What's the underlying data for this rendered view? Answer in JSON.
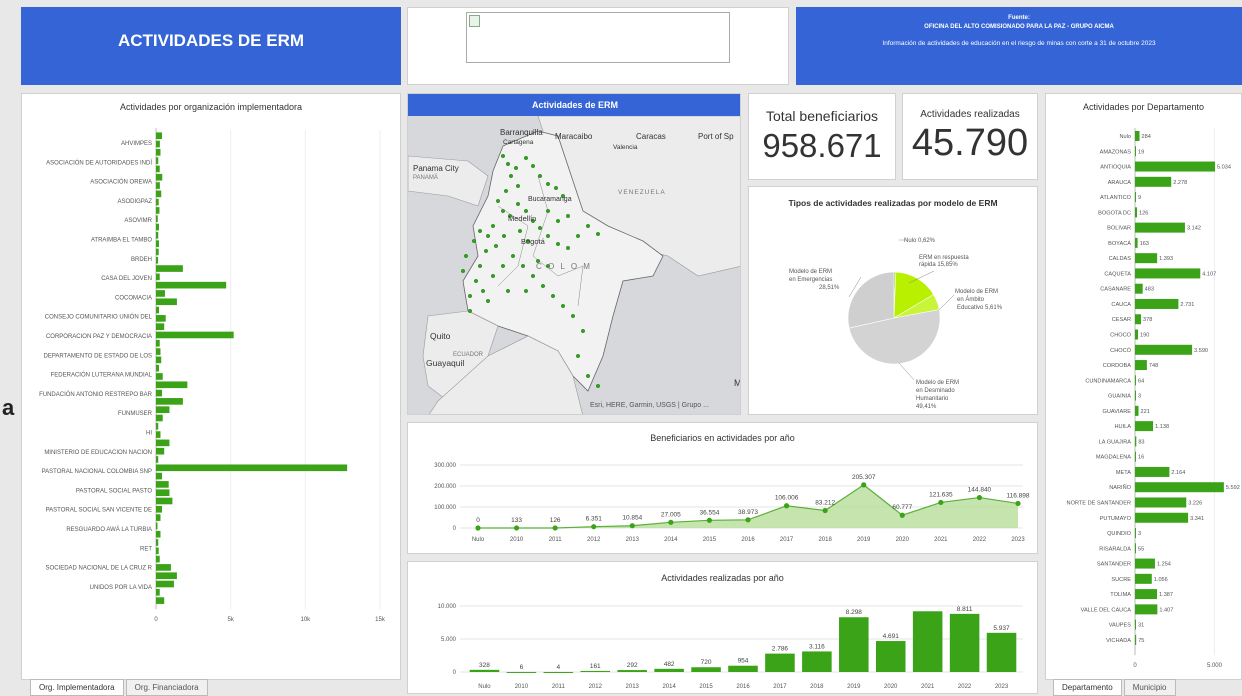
{
  "header": {
    "title": "ACTIVIDADES DE ERM",
    "source_label": "Fuente:",
    "source_org": "OFICINA DEL ALTO COMISIONADO PARA LA PAZ - GRUPO AICMA",
    "source_note": "Información de actividades de educación en el riesgo de minas con corte a 31 de octubre 2023"
  },
  "side_letter": "a",
  "kpis": {
    "beneficiarios_label": "Total beneficiarios",
    "beneficiarios_value": "958.671",
    "actividades_label": "Actividades realizadas",
    "actividades_value": "45.790"
  },
  "map": {
    "title": "Actividades de ERM",
    "labels": {
      "barranquilla": "Barranquilla",
      "cartagena": "Cartagena",
      "maracaibo": "Maracaibo",
      "caracas": "Caracas",
      "valencia": "Valencia",
      "port": "Port of Sp",
      "panama_city": "Panama City",
      "panama": "PANAMÁ",
      "venezuela": "VENEZUELA",
      "medellin": "Medellín",
      "bucaramanga": "Bucaramanga",
      "bogota": "Bogotá",
      "colombia": "C O L O M",
      "quito": "Quito",
      "ecuador": "ECUADOR",
      "guayaquil": "Guayaquil",
      "m": "M"
    },
    "attribution": "Esri, HERE, Garmin, USGS | Grupo ..."
  },
  "tabs_left": [
    "Org. Implementadora",
    "Org. Financiadora"
  ],
  "tabs_right": [
    "Departamento",
    "Municipio"
  ],
  "colors": {
    "accent": "#3464d6",
    "bar": "#3aa317",
    "pie_grey": "#d3d3d3",
    "pie_lime": "#b8f000"
  },
  "chart_data": [
    {
      "type": "bar",
      "orientation": "horizontal",
      "title": "Actividades por organización implementadora",
      "categories": [
        "AHVIMPES",
        "ASOCIACIÓN DE AUTORIDADES INDÍ",
        "ASOCIACIÓN OREWA",
        "ASODIGPAZ",
        "ASOVIMR",
        "ATRAIMBA EL TAMBO",
        "BRDEH",
        "CASA DEL JOVEN",
        "COCOMACIA",
        "CONSEJO COMUNITARIO UNIÓN DEL",
        "CORPORACION PAZ Y DEMOCRACIA",
        "DEPARTAMENTO DE ESTADO DE LOS",
        "FEDERACIÓN LUTERANA MUNDIAL",
        "FUNDACIÓN ANTONIO RESTREPO BAR",
        "FUNMUSER",
        "HI",
        "MINISTERIO DE EDUCACION NACION",
        "PASTORAL NACIONAL COLOMBIA SNP",
        "PASTORAL SOCIAL PASTO",
        "PASTORAL SOCIAL SAN VICENTE DE",
        "RESGUARDO AWÁ LA TURBIA",
        "RET",
        "SOCIEDAD NACIONAL DE LA CRUZ R",
        "UNIDOS POR LA VIDA"
      ],
      "xticks": [
        "0",
        "5k",
        "10k",
        "15k"
      ],
      "xlim": [
        0,
        15000
      ],
      "values": [
        400,
        260,
        300,
        150,
        250,
        420,
        260,
        350,
        180,
        230,
        120,
        200,
        150,
        200,
        180,
        140,
        1800,
        250,
        4700,
        600,
        1400,
        200,
        650,
        550,
        5200,
        250,
        300,
        350,
        200,
        450,
        2100,
        400,
        1800,
        900,
        450,
        150,
        300,
        900,
        550,
        150,
        12800,
        400,
        850,
        900,
        1100,
        400,
        300,
        80,
        300,
        150,
        180,
        250,
        1000,
        1400,
        1200,
        250,
        550
      ],
      "groups_per_category": 2
    },
    {
      "type": "line",
      "title": "Beneficiarios en actividades por año",
      "x": [
        "Nulo",
        "2010",
        "2011",
        "2012",
        "2013",
        "2014",
        "2015",
        "2016",
        "2017",
        "2018",
        "2019",
        "2020",
        "2021",
        "2022",
        "2023"
      ],
      "y": [
        0,
        133,
        126,
        6351,
        10854,
        27005,
        36554,
        38973,
        106006,
        83212,
        205307,
        60777,
        121635,
        144840,
        116898
      ],
      "labels": [
        "0",
        "133",
        "126",
        "6.351",
        "10.854",
        "27.005",
        "36.554",
        "38.973",
        "106.006",
        "83.212",
        "205.307",
        "60.777",
        "121.635",
        "144.840",
        "116.898"
      ],
      "yticks": [
        "0",
        "100.000",
        "200.000",
        "300.000"
      ],
      "ylim": [
        0,
        300000
      ]
    },
    {
      "type": "bar",
      "title": "Actividades realizadas por año",
      "categories": [
        "Nulo",
        "2010",
        "2011",
        "2012",
        "2013",
        "2014",
        "2015",
        "2016",
        "2017",
        "2018",
        "2019",
        "2020",
        "2021",
        "2022",
        "2023"
      ],
      "values": [
        328,
        6,
        4,
        161,
        292,
        482,
        720,
        954,
        2786,
        3116,
        8298,
        4691,
        9200,
        8811,
        5937
      ],
      "labels": [
        "328",
        "6",
        "4",
        "161",
        "292",
        "482",
        "720",
        "954",
        "2.786",
        "3.116",
        "8.298",
        "4.691",
        "",
        "8.811",
        "5.937"
      ],
      "yticks": [
        "0",
        "5.000",
        "10.000"
      ],
      "ylim": [
        0,
        10000
      ]
    },
    {
      "type": "pie",
      "title": "Tipos de actividades realizadas por modelo de ERM",
      "slices": [
        {
          "label": "Nulo 0,62%",
          "value": 0.62
        },
        {
          "label": "ERM en respuesta rápida 15,85%",
          "value": 15.85
        },
        {
          "label": "Modelo de ERM en Ámbito Educativo 5,61%",
          "value": 5.61
        },
        {
          "label": "Modelo de ERM en Desminado Humanitario 49,41%",
          "value": 49.41
        },
        {
          "label": "Modelo de ERM en Emergencias 28,51%",
          "value": 28.51
        }
      ],
      "text": {
        "nulo": "Nulo 0,62%",
        "erm1": "ERM en respuesta",
        "erm2": "rápida 15,85%",
        "amb1": "Modelo de ERM",
        "amb2": "en Ámbito",
        "amb3": "Educativo 5,61%",
        "des1": "Modelo de ERM",
        "des2": "en Desminado",
        "des3": "Humanitario",
        "des4": "49,41%",
        "eme1": "Modelo de ERM",
        "eme2": "en Emergencias",
        "eme3": "28,51%"
      }
    },
    {
      "type": "bar",
      "orientation": "horizontal",
      "title": "Actividades por Departamento",
      "categories": [
        "Nulo",
        "AMAZONAS",
        "ANTIOQUIA",
        "ARAUCA",
        "ATLANTICO",
        "BOGOTA DC",
        "BOLIVAR",
        "BOYACÁ",
        "CALDAS",
        "CAQUETA",
        "CASANARE",
        "CAUCA",
        "CESAR",
        "CHOCO",
        "CHOCÓ",
        "CORDOBA",
        "CUNDINAMARCA",
        "GUAINIA",
        "GUAVIARE",
        "HUILA",
        "LA GUAJIRA",
        "MAGDALENA",
        "META",
        "NARIÑO",
        "NORTE DE SANTANDER",
        "PUTUMAYO",
        "QUINDIO",
        "RISARALDA",
        "SANTANDER",
        "SUCRE",
        "TOLIMA",
        "VALLE DEL CAUCA",
        "VAUPES",
        "VICHADA"
      ],
      "values": [
        284,
        19,
        5034,
        2278,
        9,
        126,
        3142,
        163,
        1393,
        4107,
        483,
        2731,
        378,
        190,
        3590,
        748,
        64,
        3,
        221,
        1138,
        83,
        16,
        2164,
        5592,
        3226,
        3341,
        3,
        55,
        1254,
        1056,
        1387,
        1407,
        31,
        75
      ],
      "labels": [
        "284",
        "19",
        "5.034",
        "2.278",
        "9",
        "126",
        "3.142",
        "163",
        "1.393",
        "4.107",
        "483",
        "2.731",
        "378",
        "190",
        "3.590",
        "748",
        "64",
        "3",
        "221",
        "1.138",
        "83",
        "16",
        "2.164",
        "5.592",
        "3.226",
        "3.341",
        "3",
        "55",
        "1.254",
        "1.056",
        "1.387",
        "1.407",
        "31",
        "75"
      ],
      "xticks": [
        "0",
        "5.000"
      ],
      "xlim": [
        0,
        9500
      ]
    }
  ]
}
